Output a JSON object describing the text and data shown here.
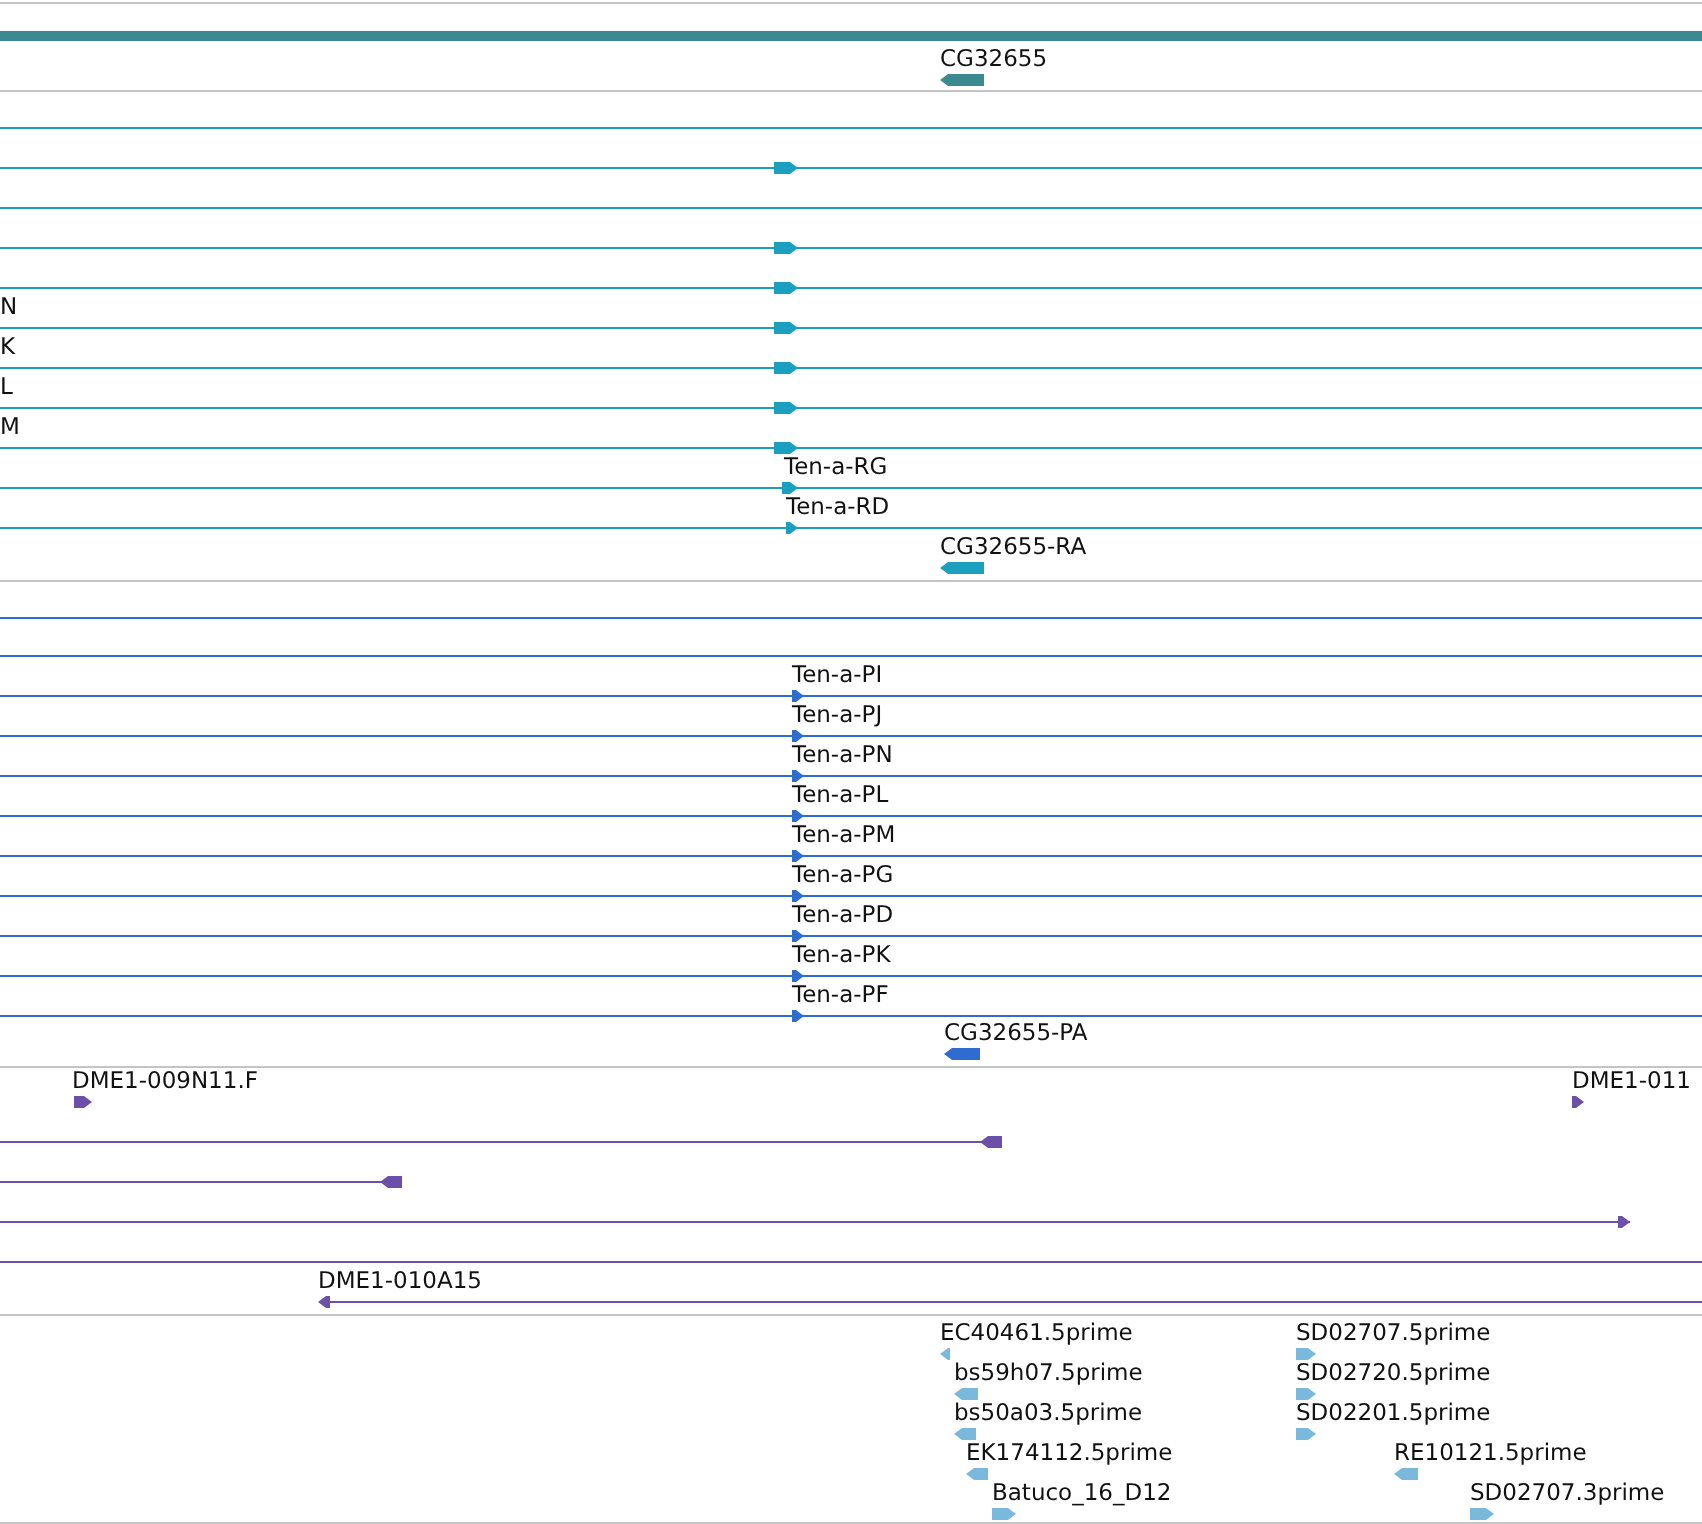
{
  "tracks": [
    {
      "color": "#3a8a8f",
      "features": [
        {
          "kind": "bar"
        },
        {
          "kind": "glyph",
          "label": "CG32655",
          "reverse": true
        }
      ]
    },
    {
      "color": "#1a9fbf",
      "features": [
        {
          "kind": "line"
        },
        {
          "kind": "line",
          "reverse": false
        },
        {
          "kind": "line"
        },
        {
          "kind": "line",
          "reverse": false
        },
        {
          "kind": "line",
          "reverse": false
        },
        {
          "kind": "line",
          "reverse": false,
          "label": "N"
        },
        {
          "kind": "line",
          "reverse": false,
          "label": "K"
        },
        {
          "kind": "line",
          "reverse": false,
          "label": "L"
        },
        {
          "kind": "line",
          "reverse": false,
          "label": "M"
        },
        {
          "kind": "line",
          "reverse": false,
          "label": "Ten-a-RG"
        },
        {
          "kind": "line",
          "reverse": false,
          "label": "Ten-a-RD"
        },
        {
          "kind": "glyph",
          "reverse": true,
          "label": "CG32655-RA"
        }
      ]
    },
    {
      "color": "#2f6cd0",
      "features": [
        {
          "kind": "line"
        },
        {
          "kind": "line"
        },
        {
          "kind": "line",
          "reverse": false,
          "label": "Ten-a-PI"
        },
        {
          "kind": "line",
          "reverse": false,
          "label": "Ten-a-PJ"
        },
        {
          "kind": "line",
          "reverse": false,
          "label": "Ten-a-PN"
        },
        {
          "kind": "line",
          "reverse": false,
          "label": "Ten-a-PL"
        },
        {
          "kind": "line",
          "reverse": false,
          "label": "Ten-a-PM"
        },
        {
          "kind": "line",
          "reverse": false,
          "label": "Ten-a-PG"
        },
        {
          "kind": "line",
          "reverse": false,
          "label": "Ten-a-PD"
        },
        {
          "kind": "line",
          "reverse": false,
          "label": "Ten-a-PK"
        },
        {
          "kind": "line",
          "reverse": false,
          "label": "Ten-a-PF"
        },
        {
          "kind": "glyph",
          "reverse": true,
          "label": "CG32655-PA"
        }
      ]
    },
    {
      "color": "#6c4fa8",
      "features": [
        {
          "kind": "glyph",
          "reverse": false,
          "label": "DME1-009N11.F"
        },
        {
          "kind": "glyph",
          "reverse": false,
          "label": "DME1-011"
        },
        {
          "kind": "line",
          "reverse": true
        },
        {
          "kind": "line",
          "reverse": true
        },
        {
          "kind": "line",
          "reverse": false
        },
        {
          "kind": "line"
        },
        {
          "kind": "line",
          "reverse": true,
          "label": "DME1-010A15"
        }
      ]
    },
    {
      "color": "#7ab8dc",
      "features": [
        {
          "kind": "glyph",
          "reverse": true,
          "label": "EC40461.5prime"
        },
        {
          "kind": "glyph",
          "reverse": true,
          "label": "bs59h07.5prime"
        },
        {
          "kind": "glyph",
          "reverse": true,
          "label": "bs50a03.5prime"
        },
        {
          "kind": "glyph",
          "reverse": true,
          "label": "EK174112.5prime"
        },
        {
          "kind": "glyph",
          "reverse": false,
          "label": "Batuco_16_D12"
        },
        {
          "kind": "glyph",
          "reverse": false,
          "label": "SD02707.5prime"
        },
        {
          "kind": "glyph",
          "reverse": false,
          "label": "SD02720.5prime"
        },
        {
          "kind": "glyph",
          "reverse": false,
          "label": "SD02201.5prime"
        },
        {
          "kind": "glyph",
          "reverse": true,
          "label": "RE10121.5prime"
        },
        {
          "kind": "glyph",
          "reverse": false,
          "label": "SD02707.3prime"
        }
      ]
    }
  ]
}
